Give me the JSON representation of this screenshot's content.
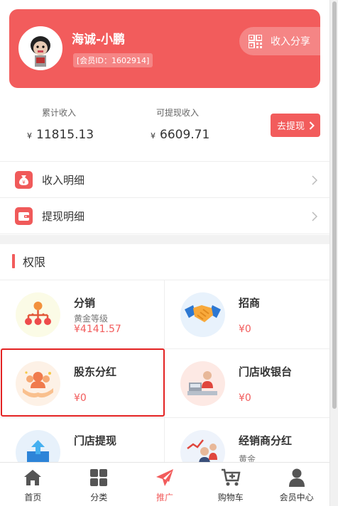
{
  "header": {
    "user_name": "海诚-小鹏",
    "member_id": "[会员ID：1602914]",
    "share_label": "收入分享"
  },
  "income": {
    "total_label": "累计收入",
    "total_currency": "¥",
    "total_value": "11815.13",
    "withdrawable_label": "可提现收入",
    "withdrawable_currency": "¥",
    "withdrawable_value": "6609.71",
    "withdraw_button": "去提现"
  },
  "menu": [
    {
      "label": "收入明细",
      "icon": "money-bag-icon"
    },
    {
      "label": "提现明细",
      "icon": "wallet-icon"
    }
  ],
  "section_title": "权限",
  "grid": [
    {
      "name": "分销",
      "sub": "黄金等级",
      "value": "¥4141.57",
      "icon": "distribution-tree-icon"
    },
    {
      "name": "招商",
      "sub": "",
      "value": "¥0",
      "icon": "handshake-icon"
    },
    {
      "name": "股东分红",
      "sub": "",
      "value": "¥0",
      "icon": "shareholder-icon"
    },
    {
      "name": "门店收银台",
      "sub": "",
      "value": "¥0",
      "icon": "cashier-icon"
    },
    {
      "name": "门店提现",
      "sub": "",
      "value": "",
      "icon": "store-withdraw-icon"
    },
    {
      "name": "经销商分红",
      "sub": "黄金",
      "value": "",
      "icon": "dealer-icon"
    }
  ],
  "nav": [
    {
      "label": "首页",
      "icon": "home-icon",
      "active": false
    },
    {
      "label": "分类",
      "icon": "grid-icon",
      "active": false
    },
    {
      "label": "推广",
      "icon": "paper-plane-icon",
      "active": true
    },
    {
      "label": "购物车",
      "icon": "cart-icon",
      "active": false
    },
    {
      "label": "会员中心",
      "icon": "user-icon",
      "active": false
    }
  ],
  "colors": {
    "accent": "#f25c5c",
    "highlight_border": "#e32222"
  }
}
